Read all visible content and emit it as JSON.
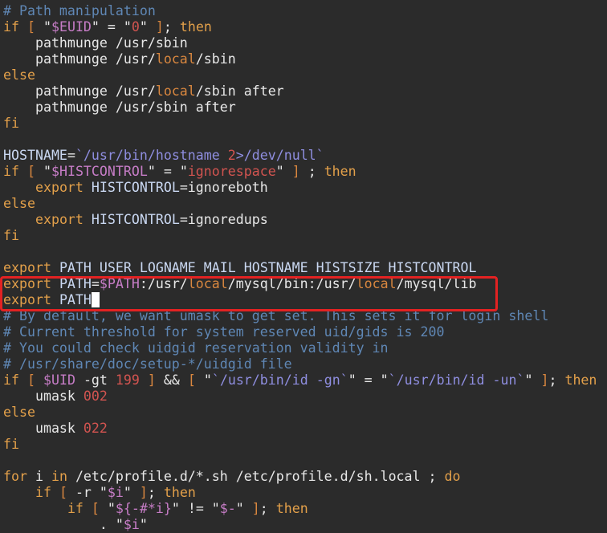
{
  "highlight_color": "#e32222",
  "lines": [
    [
      [
        "# Path manipulation",
        "c"
      ]
    ],
    [
      [
        "if",
        "k"
      ],
      [
        " ",
        "n"
      ],
      [
        "[",
        "p"
      ],
      [
        " \"",
        "n"
      ],
      [
        "$EUID",
        "v"
      ],
      [
        "\" = \"",
        "n"
      ],
      [
        "0",
        "s"
      ],
      [
        "\" ",
        "n"
      ],
      [
        "]",
        "p"
      ],
      [
        "; ",
        "n"
      ],
      [
        "then",
        "k"
      ]
    ],
    [
      [
        "    pathmunge /usr/sbin",
        "n"
      ]
    ],
    [
      [
        "    pathmunge /usr/",
        "n"
      ],
      [
        "local",
        "p"
      ],
      [
        "/sbin",
        "n"
      ]
    ],
    [
      [
        "else",
        "k"
      ]
    ],
    [
      [
        "    pathmunge /usr/",
        "n"
      ],
      [
        "local",
        "p"
      ],
      [
        "/sbin after",
        "n"
      ]
    ],
    [
      [
        "    pathmunge /usr/sbin after",
        "n"
      ]
    ],
    [
      [
        "fi",
        "k"
      ]
    ],
    [],
    [
      [
        "HOSTNAME",
        "id"
      ],
      [
        "=",
        "n"
      ],
      [
        "`/usr/bin/hostname ",
        "b"
      ],
      [
        "2",
        "s"
      ],
      [
        ">/dev/null`",
        "b"
      ]
    ],
    [
      [
        "if",
        "k"
      ],
      [
        " ",
        "n"
      ],
      [
        "[",
        "p"
      ],
      [
        " \"",
        "n"
      ],
      [
        "$HISTCONTROL",
        "v"
      ],
      [
        "\" = \"",
        "n"
      ],
      [
        "ignorespace",
        "s"
      ],
      [
        "\" ",
        "n"
      ],
      [
        "]",
        "p"
      ],
      [
        " ; ",
        "n"
      ],
      [
        "then",
        "k"
      ]
    ],
    [
      [
        "    ",
        "n"
      ],
      [
        "export",
        "k"
      ],
      [
        " HISTCONTROL",
        "id"
      ],
      [
        "=ignoreboth",
        "n"
      ]
    ],
    [
      [
        "else",
        "k"
      ]
    ],
    [
      [
        "    ",
        "n"
      ],
      [
        "export",
        "k"
      ],
      [
        " HISTCONTROL",
        "id"
      ],
      [
        "=ignoredups",
        "n"
      ]
    ],
    [
      [
        "fi",
        "k"
      ]
    ],
    [],
    [
      [
        "export",
        "k"
      ],
      [
        " PATH USER LOGNAME MAIL HOSTNAME HISTSIZE HISTCONTROL",
        "id"
      ]
    ],
    [
      [
        "export",
        "k"
      ],
      [
        " PATH",
        "id"
      ],
      [
        "=",
        "n"
      ],
      [
        "$PATH",
        "v"
      ],
      [
        ":/usr/",
        "n"
      ],
      [
        "local",
        "p"
      ],
      [
        "/mysql/bin:/usr/",
        "n"
      ],
      [
        "local",
        "p"
      ],
      [
        "/mysql/lib",
        "n"
      ]
    ],
    [
      [
        "export",
        "k"
      ],
      [
        " PATH",
        "id"
      ]
    ],
    [
      [
        "# By default, we want umask to get set. This sets it for login shell",
        "c"
      ]
    ],
    [
      [
        "# Current threshold for system reserved uid/gids is 200",
        "c"
      ]
    ],
    [
      [
        "# You could check uidgid reservation validity in",
        "c"
      ]
    ],
    [
      [
        "# /usr/share/doc/setup-*/uidgid file",
        "c"
      ]
    ],
    [
      [
        "if",
        "k"
      ],
      [
        " ",
        "n"
      ],
      [
        "[",
        "p"
      ],
      [
        " ",
        "n"
      ],
      [
        "$UID",
        "v"
      ],
      [
        " -gt ",
        "n"
      ],
      [
        "199",
        "s"
      ],
      [
        " ",
        "n"
      ],
      [
        "]",
        "p"
      ],
      [
        " && ",
        "n"
      ],
      [
        "[",
        "p"
      ],
      [
        " \"",
        "n"
      ],
      [
        "`/usr/bin/id -gn`",
        "b"
      ],
      [
        "\" = \"",
        "n"
      ],
      [
        "`/usr/bin/id -un`",
        "b"
      ],
      [
        "\" ",
        "n"
      ],
      [
        "]",
        "p"
      ],
      [
        "; ",
        "n"
      ],
      [
        "then",
        "k"
      ]
    ],
    [
      [
        "    umask ",
        "n"
      ],
      [
        "002",
        "s"
      ]
    ],
    [
      [
        "else",
        "k"
      ]
    ],
    [
      [
        "    umask ",
        "n"
      ],
      [
        "022",
        "s"
      ]
    ],
    [
      [
        "fi",
        "k"
      ]
    ],
    [],
    [
      [
        "for",
        "k"
      ],
      [
        " i ",
        "n"
      ],
      [
        "in",
        "k"
      ],
      [
        " /etc/profile.d/*.sh /etc/profile.d/sh.local ; ",
        "n"
      ],
      [
        "do",
        "k"
      ]
    ],
    [
      [
        "    ",
        "n"
      ],
      [
        "if",
        "k"
      ],
      [
        " ",
        "n"
      ],
      [
        "[",
        "p"
      ],
      [
        " -r \"",
        "n"
      ],
      [
        "$i",
        "v"
      ],
      [
        "\" ",
        "n"
      ],
      [
        "]",
        "p"
      ],
      [
        "; ",
        "n"
      ],
      [
        "then",
        "k"
      ]
    ],
    [
      [
        "        ",
        "n"
      ],
      [
        "if",
        "k"
      ],
      [
        " ",
        "n"
      ],
      [
        "[",
        "p"
      ],
      [
        " \"",
        "n"
      ],
      [
        "${-#*i}",
        "v"
      ],
      [
        "\" != \"",
        "n"
      ],
      [
        "$-",
        "v"
      ],
      [
        "\" ",
        "n"
      ],
      [
        "]",
        "p"
      ],
      [
        "; ",
        "n"
      ],
      [
        "then",
        "k"
      ]
    ],
    [
      [
        "            . \"",
        "n"
      ],
      [
        "$i",
        "v"
      ],
      [
        "\"",
        "n"
      ]
    ]
  ],
  "cursor_line": 18
}
